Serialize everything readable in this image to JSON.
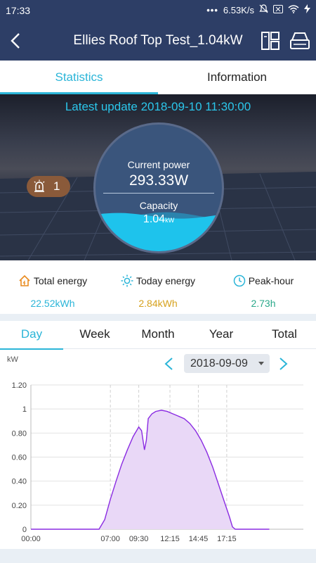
{
  "status_bar": {
    "time": "17:33",
    "dots": "•••",
    "speed": "6.53K/s"
  },
  "header": {
    "title": "Ellies Roof Top Test_1.04kW"
  },
  "tabs": [
    {
      "label": "Statistics",
      "active": true
    },
    {
      "label": "Information",
      "active": false
    }
  ],
  "hero": {
    "latest_update": "Latest update 2018-09-10 11:30:00",
    "alarm_count": "1",
    "current_power_label": "Current power",
    "current_power_value": "293.33W",
    "capacity_label": "Capacity",
    "capacity_value": "1.04",
    "capacity_unit": "kW",
    "fill_fraction": 0.28
  },
  "stats": [
    {
      "label": "Total energy",
      "value": "22.52kWh",
      "icon": "home-icon",
      "color": "#2bb5d8"
    },
    {
      "label": "Today energy",
      "value": "2.84kWh",
      "icon": "sun-icon",
      "color": "#d6a21e"
    },
    {
      "label": "Peak-hour",
      "value": "2.73h",
      "icon": "clock-icon",
      "color": "#2aa88a"
    }
  ],
  "range_tabs": [
    {
      "label": "Day",
      "active": true
    },
    {
      "label": "Week",
      "active": false
    },
    {
      "label": "Month",
      "active": false
    },
    {
      "label": "Year",
      "active": false
    },
    {
      "label": "Total",
      "active": false
    }
  ],
  "date_selector": {
    "value": "2018-09-09"
  },
  "colors": {
    "primary": "#2d3e66",
    "accent": "#2bb5d8",
    "chart_line": "#8a2be2",
    "chart_fill": "#e9d8f7"
  },
  "chart_data": {
    "type": "area",
    "ylabel": "kW",
    "ylim": [
      0,
      1.2
    ],
    "yticks": [
      "0",
      "0.20",
      "0.40",
      "0.60",
      "0.80",
      "1",
      "1.20"
    ],
    "xticks": [
      "00:00",
      "07:00",
      "09:30",
      "12:15",
      "14:45",
      "17:15"
    ],
    "grid": true,
    "x": [
      "00:00",
      "06:00",
      "06:30",
      "07:00",
      "07:30",
      "08:00",
      "08:30",
      "09:00",
      "09:30",
      "09:45",
      "10:00",
      "10:10",
      "10:20",
      "10:40",
      "11:00",
      "11:30",
      "12:00",
      "12:30",
      "13:00",
      "13:30",
      "14:00",
      "14:30",
      "15:00",
      "15:30",
      "16:00",
      "16:30",
      "17:00",
      "17:30",
      "17:45",
      "18:00",
      "18:30",
      "19:00",
      "19:30",
      "20:00",
      "21:00"
    ],
    "y": [
      0,
      0,
      0.08,
      0.25,
      0.4,
      0.54,
      0.66,
      0.77,
      0.85,
      0.82,
      0.66,
      0.74,
      0.92,
      0.96,
      0.98,
      0.99,
      0.98,
      0.96,
      0.94,
      0.92,
      0.88,
      0.82,
      0.74,
      0.64,
      0.52,
      0.38,
      0.24,
      0.1,
      0.02,
      0,
      0,
      0,
      0,
      0,
      0
    ]
  }
}
